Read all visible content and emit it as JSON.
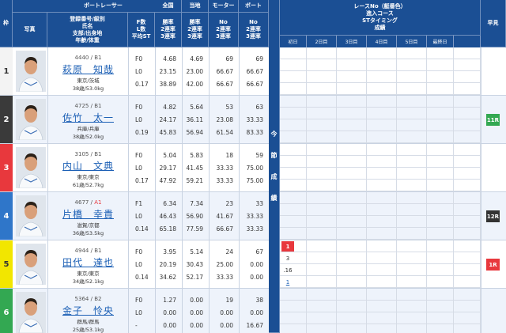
{
  "header": {
    "waku": "枠",
    "photo": "写真",
    "boat_racer": "ボートレーサー",
    "racer_info": [
      "登録番号/級別",
      "氏名",
      "支部/出身地",
      "年齢/体重"
    ],
    "flst": [
      "F数",
      "L数",
      "平均ST"
    ],
    "zenkoku": "全国",
    "touchi": "当地",
    "motor": "モーター",
    "boat": "ボート",
    "rate_cols": [
      "勝率",
      "2連率",
      "3連率"
    ],
    "no_cols": [
      "No",
      "2連率",
      "3連率"
    ],
    "konsetsu": [
      "今",
      "節",
      "成",
      "績"
    ],
    "race_info": [
      "レースNo（艇番色）",
      "進入コース",
      "STタイミング",
      "成績"
    ],
    "days": [
      "初日",
      "2日目",
      "3日目",
      "4日目",
      "5日目",
      "最終日"
    ],
    "early": "早見"
  },
  "racers": [
    {
      "waku": "1",
      "waku_color": "#f3f3f3",
      "waku_text": "#333",
      "id": "4440",
      "klass": "B1",
      "name": "萩原　知哉",
      "home": "東京/茨城",
      "age": "38歳/53.0kg",
      "fl": [
        "F0",
        "L0",
        "0.17"
      ],
      "zenkoku": [
        "4.68",
        "23.15",
        "38.89"
      ],
      "touchi": [
        "4.69",
        "23.00",
        "42.00"
      ],
      "motor": [
        "69",
        "66.67",
        "66.67"
      ],
      "boat": [
        "69",
        "66.67",
        "66.67"
      ]
    },
    {
      "waku": "2",
      "waku_color": "#3a3a3a",
      "waku_text": "#fff",
      "id": "4725",
      "klass": "B1",
      "name": "佐竹　太一",
      "home": "兵庫/兵庫",
      "age": "38歳/52.0kg",
      "fl": [
        "F0",
        "L0",
        "0.19"
      ],
      "zenkoku": [
        "4.82",
        "24.17",
        "45.83"
      ],
      "touchi": [
        "5.64",
        "36.11",
        "56.94"
      ],
      "motor": [
        "53",
        "23.08",
        "61.54"
      ],
      "boat": [
        "63",
        "33.33",
        "83.33"
      ]
    },
    {
      "waku": "3",
      "waku_color": "#e8383d",
      "waku_text": "#fff",
      "id": "3105",
      "klass": "B1",
      "name": "内山　文典",
      "home": "東京/東京",
      "age": "61歳/52.7kg",
      "fl": [
        "F0",
        "L0",
        "0.17"
      ],
      "zenkoku": [
        "5.04",
        "29.17",
        "47.92"
      ],
      "touchi": [
        "5.83",
        "41.45",
        "59.21"
      ],
      "motor": [
        "18",
        "33.33",
        "33.33"
      ],
      "boat": [
        "59",
        "75.00",
        "75.00"
      ]
    },
    {
      "waku": "4",
      "waku_color": "#2f76c9",
      "waku_text": "#fff",
      "id": "4677",
      "klass": "A1",
      "name": "片橋　幸貴",
      "home": "滋賀/京都",
      "age": "36歳/53.5kg",
      "fl": [
        "F1",
        "L0",
        "0.14"
      ],
      "zenkoku": [
        "6.34",
        "46.43",
        "65.18"
      ],
      "touchi": [
        "7.34",
        "56.90",
        "77.59"
      ],
      "motor": [
        "23",
        "41.67",
        "66.67"
      ],
      "boat": [
        "33",
        "33.33",
        "33.33"
      ]
    },
    {
      "waku": "5",
      "waku_color": "#f2e600",
      "waku_text": "#333",
      "id": "4944",
      "klass": "B1",
      "name": "田代　達也",
      "home": "東京/東京",
      "age": "34歳/52.1kg",
      "fl": [
        "F0",
        "L0",
        "0.14"
      ],
      "zenkoku": [
        "3.95",
        "20.19",
        "34.62"
      ],
      "touchi": [
        "5.14",
        "30.43",
        "52.17"
      ],
      "motor": [
        "24",
        "25.00",
        "33.33"
      ],
      "boat": [
        "67",
        "0.00",
        "0.00"
      ]
    },
    {
      "waku": "6",
      "waku_color": "#33a852",
      "waku_text": "#fff",
      "id": "5364",
      "klass": "B2",
      "name": "金子　怜央",
      "home": "群馬/群馬",
      "age": "25歳/53.1kg",
      "fl": [
        "F0",
        "L0",
        "-"
      ],
      "zenkoku": [
        "1.27",
        "0.00",
        "0.00"
      ],
      "touchi": [
        "0.00",
        "0.00",
        "0.00"
      ],
      "motor": [
        "19",
        "0.00",
        "0.00"
      ],
      "boat": [
        "38",
        "0.00",
        "16.67"
      ]
    }
  ],
  "results": {
    "racer5_day1": {
      "race": "1",
      "course": "3",
      "st": ".16",
      "rank": "1"
    }
  },
  "hayami": [
    {
      "row": "2",
      "label": "11R",
      "color": "#33a852"
    },
    {
      "row": "4",
      "label": "12R",
      "color": "#333333"
    },
    {
      "row": "5",
      "label": "1R",
      "color": "#e8383d"
    }
  ],
  "colors": {
    "header_bg": "#1b4f94",
    "a1_class": "#e8383d",
    "link": "#1b5fb5"
  }
}
